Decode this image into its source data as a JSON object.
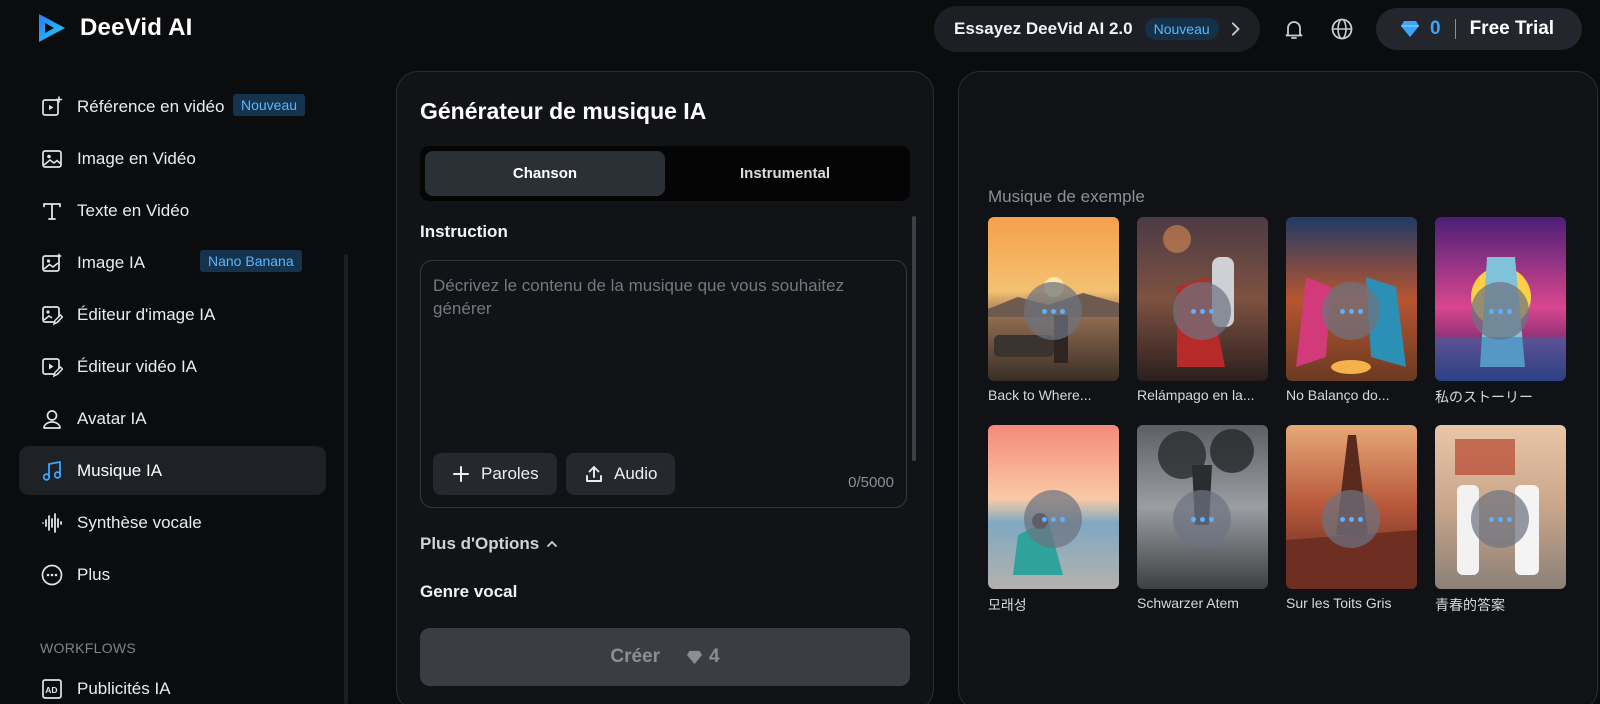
{
  "header": {
    "brand": "DeeVid AI",
    "promo_text": "Essayez DeeVid AI 2.0",
    "promo_badge": "Nouveau",
    "credits": "0",
    "trial_label": "Free Trial"
  },
  "sidebar": {
    "items": [
      {
        "label": "Référence en vidéo",
        "badge": "Nouveau",
        "icon": "video-reference-icon"
      },
      {
        "label": "Image en Vidéo",
        "icon": "image-icon"
      },
      {
        "label": "Texte en Vidéo",
        "icon": "text-icon"
      },
      {
        "label": "Image IA",
        "badge": "Nano Banana",
        "icon": "ai-image-icon"
      },
      {
        "label": "Éditeur d'image IA",
        "icon": "image-edit-icon"
      },
      {
        "label": "Éditeur vidéo IA",
        "icon": "video-edit-icon"
      },
      {
        "label": "Avatar IA",
        "icon": "avatar-icon"
      },
      {
        "label": "Musique IA",
        "icon": "music-icon"
      },
      {
        "label": "Synthèse vocale",
        "icon": "waveform-icon"
      },
      {
        "label": "Plus",
        "icon": "more-icon"
      }
    ],
    "workflows_heading": "WORKFLOWS",
    "workflow_items": [
      {
        "label": "Publicités IA",
        "icon": "ads-icon"
      }
    ]
  },
  "generator": {
    "title": "Générateur de musique IA",
    "tabs": [
      "Chanson",
      "Instrumental"
    ],
    "instruction_label": "Instruction",
    "prompt_placeholder": "Décrivez le contenu de la musique que vous souhaitez générer",
    "lyrics_button": "Paroles",
    "audio_button": "Audio",
    "char_counter": "0/5000",
    "more_options": "Plus d'Options",
    "vocal_genre": "Genre vocal",
    "create_label": "Créer",
    "create_cost": "4"
  },
  "examples": {
    "title": "Musique de exemple",
    "cards": [
      {
        "label": "Back to Where..."
      },
      {
        "label": "Relámpago en la..."
      },
      {
        "label": "No Balanço do..."
      },
      {
        "label": "私のストーリー"
      },
      {
        "label": "모래성"
      },
      {
        "label": "Schwarzer Atem"
      },
      {
        "label": "Sur les Toits Gris"
      },
      {
        "label": "青春的答案"
      }
    ]
  },
  "colors": {
    "accent": "#3aa7ff",
    "background": "#0b0c0e",
    "panel": "#121316"
  }
}
